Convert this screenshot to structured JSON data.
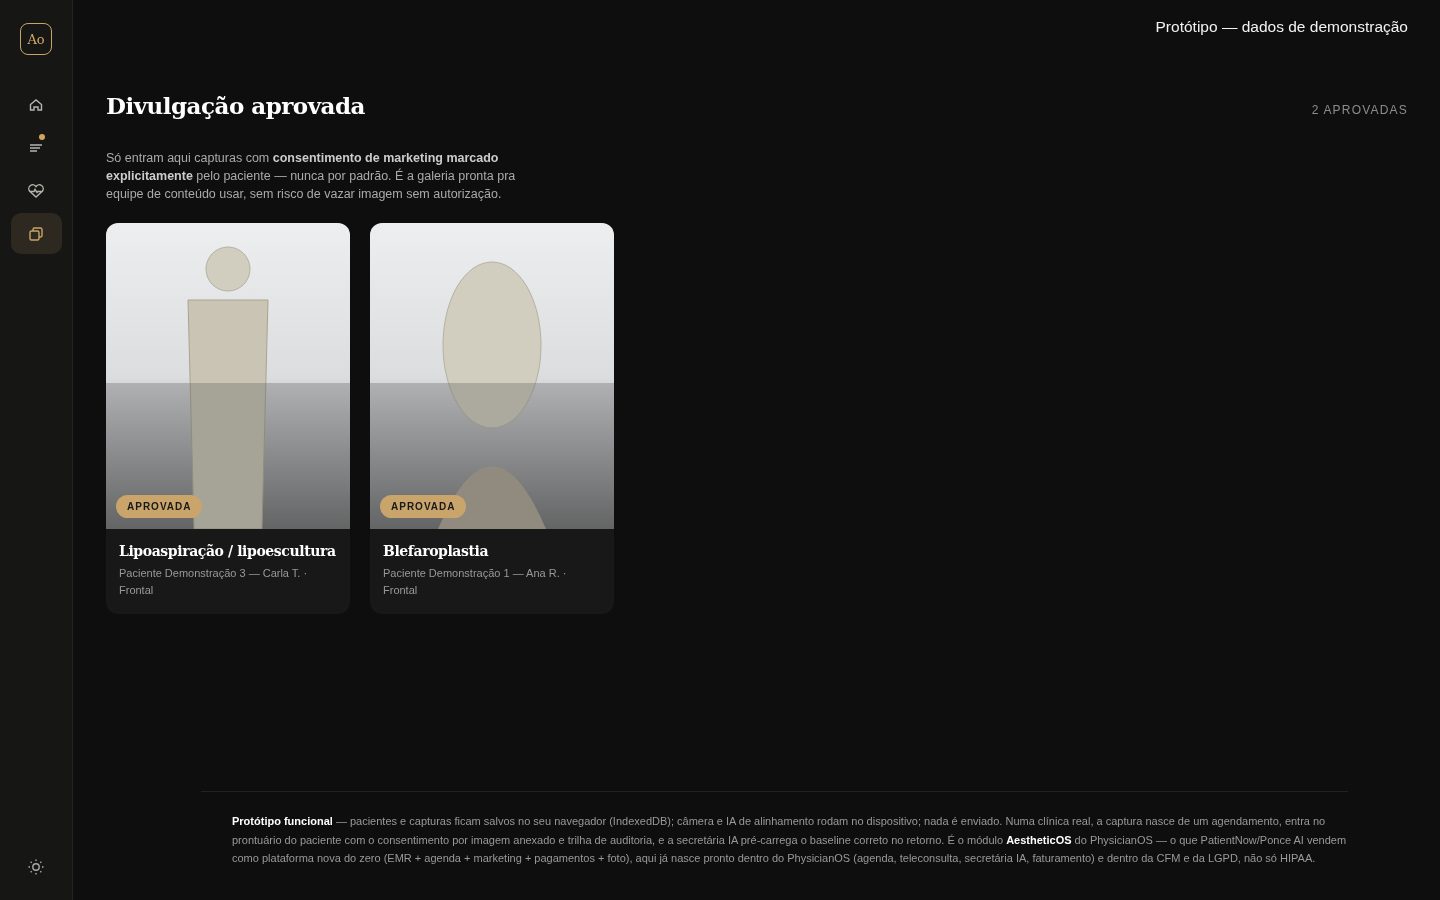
{
  "sidebar": {
    "logo": "Ao",
    "items": [
      {
        "kind": "home",
        "selected": false,
        "badge": false
      },
      {
        "kind": "list",
        "selected": false,
        "badge": true
      },
      {
        "kind": "heart",
        "selected": false,
        "badge": false
      },
      {
        "kind": "gallery",
        "selected": true,
        "badge": false
      }
    ],
    "theme_toggle": {
      "kind": "sun"
    }
  },
  "top_bar": {
    "notice": "Protótipo — dados de demonstração"
  },
  "header": {
    "title": "Divulgação aprovada",
    "count": "2 APROVADAS"
  },
  "intro": "Só entram aqui capturas com **consentimento de marketing marcado explicitamente** pelo paciente — nunca por padrão. É a galeria pronta pra equipe de conteúdo usar, sem risco de vazar imagem sem autorização.",
  "cards": [
    {
      "badge": "APROVADA",
      "title": "Lipoaspiração / lipoescultura",
      "meta": "Paciente Demonstração 3 — Carla T. · Frontal"
    },
    {
      "badge": "APROVADA",
      "title": "Blefaroplastia",
      "meta": "Paciente Demonstração 1 — Ana R. · Frontal"
    }
  ],
  "footer": "**Protótipo funcional** — pacientes e capturas ficam salvos no seu navegador (IndexedDB); câmera e IA de alinhamento rodam no dispositivo; nada é enviado. Numa clínica real, a captura nasce de um agendamento, entra no prontuário do paciente com o consentimento por imagem anexado e trilha de auditoria, e a secretária IA pré-carrega o baseline correto no retorno. É o módulo **AestheticOS** do PhysicianOS — o que PatientNow/Ponce AI vendem como plataforma nova do zero (EMR + agenda + marketing + pagamentos + foto), aqui já nasce pronto dentro do PhysicianOS (agenda, teleconsulta, secretária IA, faturamento) e dentro da CFM e da LGPD, não só HIPAA."
}
